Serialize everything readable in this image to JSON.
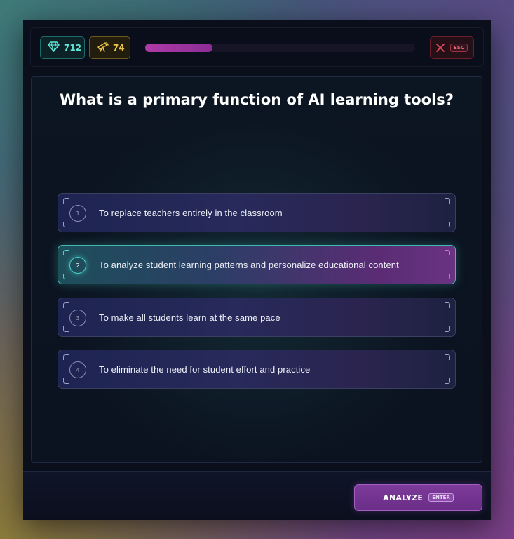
{
  "header": {
    "gems_count": "712",
    "telescope_count": "74",
    "progress_value": 0.25,
    "close_shortcut": "ESC"
  },
  "question": {
    "text": "What is a primary function of AI learning tools?"
  },
  "answers": [
    {
      "number": "1",
      "text": "To replace teachers entirely in the classroom",
      "selected": false
    },
    {
      "number": "2",
      "text": "To analyze student learning patterns and personalize educational content",
      "selected": true
    },
    {
      "number": "3",
      "text": "To make all students learn at the same pace",
      "selected": false
    },
    {
      "number": "4",
      "text": "To eliminate the need for student effort and practice",
      "selected": false
    }
  ],
  "footer": {
    "analyze_label": "ANALYZE",
    "analyze_shortcut": "ENTER"
  },
  "colors": {
    "gems": "#5fe3d4",
    "telescope": "#e7c349",
    "progress": "#b03aa6",
    "close": "#e0465a",
    "selected_accent": "#49d6cb",
    "analyze": "#7d3a9a"
  },
  "icons": {
    "gems": "diamond-icon",
    "telescope": "telescope-icon",
    "close": "close-icon"
  }
}
